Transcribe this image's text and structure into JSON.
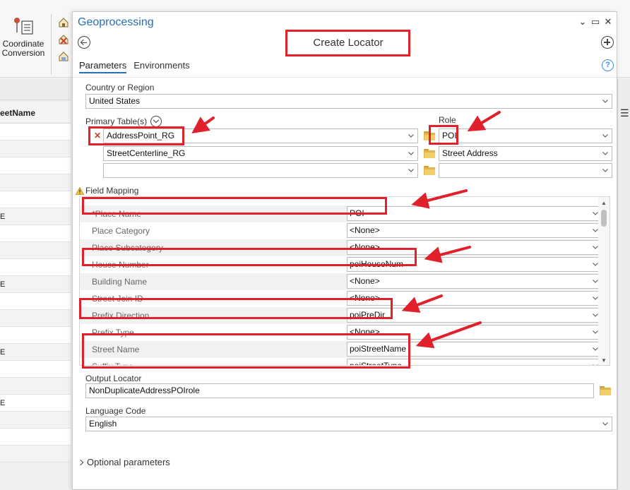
{
  "ribbon": {
    "coordinate_conversion_label": "Coordinate Conversion"
  },
  "table": {
    "column_header": "eetName",
    "row_values": [
      "",
      "",
      "",
      "",
      "",
      "E",
      "",
      "",
      "",
      "E",
      "",
      "",
      "",
      "E",
      "",
      "",
      "E",
      "",
      "",
      ""
    ]
  },
  "pane": {
    "title": "Geoprocessing",
    "tool_title": "Create Locator",
    "tabs": [
      "Parameters",
      "Environments"
    ],
    "help_icon": "?",
    "country_label": "Country or Region",
    "country_value": "United States",
    "primary_tables_label": "Primary Table(s)",
    "role_label": "Role",
    "primary_tables": [
      {
        "table": "AddressPoint_RG",
        "role": "POI"
      },
      {
        "table": "StreetCenterline_RG",
        "role": "Street Address"
      },
      {
        "table": "",
        "role": ""
      }
    ],
    "field_mapping_label": "Field Mapping",
    "field_mapping": [
      {
        "name": "*Place Name",
        "value": "POI"
      },
      {
        "name": "Place Category",
        "value": "<None>"
      },
      {
        "name": "Place Subcategory",
        "value": "<None>"
      },
      {
        "name": "House Number",
        "value": "poiHouseNum"
      },
      {
        "name": "Building Name",
        "value": "<None>"
      },
      {
        "name": "Street Join ID",
        "value": "<None>"
      },
      {
        "name": "Prefix Direction",
        "value": "poiPreDir"
      },
      {
        "name": "Prefix Type",
        "value": "<None>"
      },
      {
        "name": "Street Name",
        "value": "poiStreetName"
      },
      {
        "name": "Suffix Type",
        "value": "poiStreetType"
      }
    ],
    "output_locator_label": "Output Locator",
    "output_locator_value": "NonDuplicateAddressPOIrole",
    "language_code_label": "Language Code",
    "language_code_value": "English",
    "optional_parameters_label": "Optional parameters"
  },
  "colors": {
    "accent": "#2a6fb5",
    "annotation_red": "#e0212b",
    "remove_red": "#c8402a",
    "folder_yellow": "#f3cd68"
  },
  "icons": [
    "coordinate-conversion-icon",
    "back-arrow-icon",
    "add-icon",
    "help-icon",
    "remove-x-icon",
    "folder-icon",
    "warning-icon",
    "chevron-down-icon",
    "menu-icon"
  ]
}
